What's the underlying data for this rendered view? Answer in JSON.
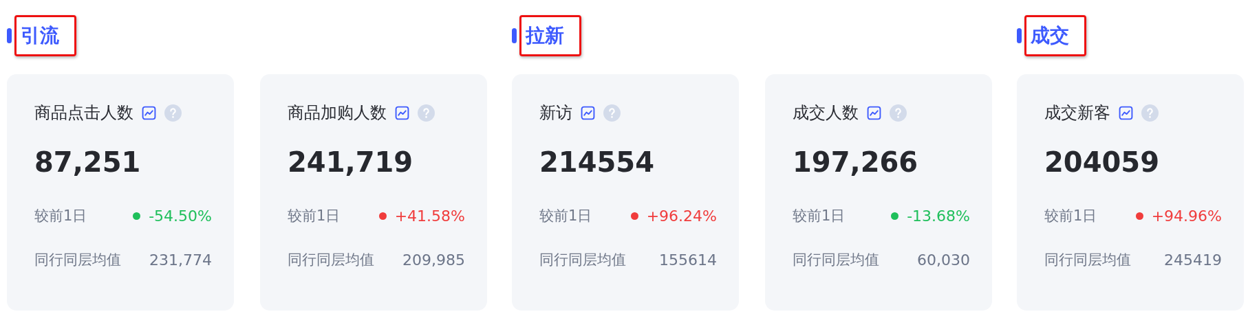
{
  "sections": [
    {
      "title": "引流",
      "highlighted": true,
      "cards": [
        {
          "title": "商品点击人数",
          "value": "87,251",
          "compare_label": "较前1日",
          "change": "-54.50%",
          "color": "#1fbf5b",
          "peer_label": "同行同层均值",
          "peer_value": "231,774"
        },
        {
          "title": "商品加购人数",
          "value": "241,719",
          "compare_label": "较前1日",
          "change": "+41.58%",
          "color": "#f03c3c",
          "peer_label": "同行同层均值",
          "peer_value": "209,985"
        }
      ]
    },
    {
      "title": "拉新",
      "highlighted": true,
      "cards": [
        {
          "title": "新访",
          "value": "214554",
          "compare_label": "较前1日",
          "change": "+96.24%",
          "color": "#f03c3c",
          "peer_label": "同行同层均值",
          "peer_value": "155614"
        },
        {
          "title": "成交人数",
          "value": "197,266",
          "compare_label": "较前1日",
          "change": "-13.68%",
          "color": "#1fbf5b",
          "peer_label": "同行同层均值",
          "peer_value": "60,030"
        }
      ]
    },
    {
      "title": "成交",
      "highlighted": true,
      "cards": [
        {
          "title": "成交新客",
          "value": "204059",
          "compare_label": "较前1日",
          "change": "+94.96%",
          "color": "#f03c3c",
          "peer_label": "同行同层均值",
          "peer_value": "245419"
        }
      ]
    }
  ]
}
